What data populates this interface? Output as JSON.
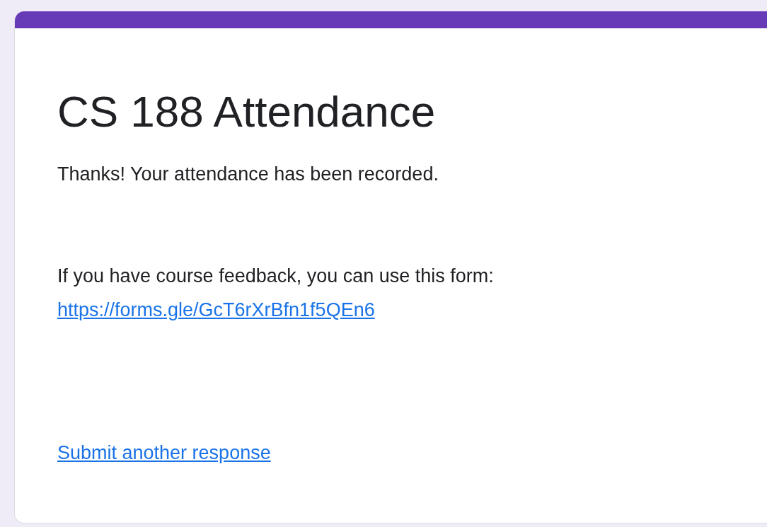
{
  "form": {
    "title": "CS 188 Attendance",
    "confirmation": "Thanks! Your attendance has been recorded.",
    "feedback_text": "If you have course feedback, you can use this form:",
    "feedback_link": "https://forms.gle/GcT6rXrBfn1f5QEn6",
    "submit_another": "Submit another response"
  }
}
